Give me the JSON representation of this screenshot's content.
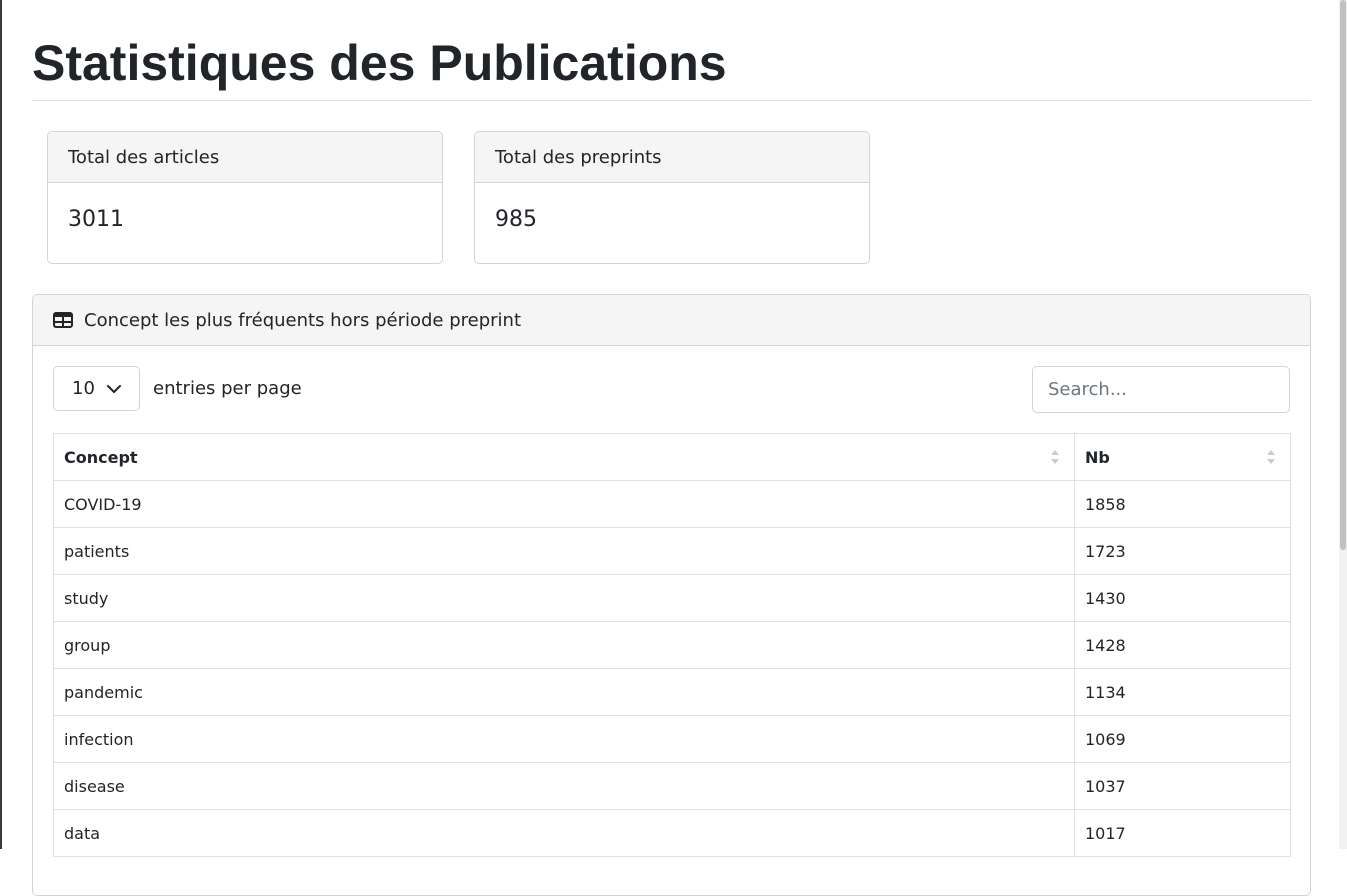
{
  "page": {
    "title": "Statistiques des Publications"
  },
  "stats": [
    {
      "label": "Total des articles",
      "value": "3011"
    },
    {
      "label": "Total des preprints",
      "value": "985"
    }
  ],
  "table_card": {
    "title": "Concept les plus fréquents hors période preprint",
    "icon": "table-icon",
    "per_page": {
      "value": "10",
      "label": "entries per page"
    },
    "search": {
      "placeholder": "Search..."
    },
    "columns": [
      "Concept",
      "Nb"
    ],
    "rows": [
      {
        "concept": "COVID-19",
        "nb": "1858"
      },
      {
        "concept": "patients",
        "nb": "1723"
      },
      {
        "concept": "study",
        "nb": "1430"
      },
      {
        "concept": "group",
        "nb": "1428"
      },
      {
        "concept": "pandemic",
        "nb": "1134"
      },
      {
        "concept": "infection",
        "nb": "1069"
      },
      {
        "concept": "disease",
        "nb": "1037"
      },
      {
        "concept": "data",
        "nb": "1017"
      }
    ]
  }
}
